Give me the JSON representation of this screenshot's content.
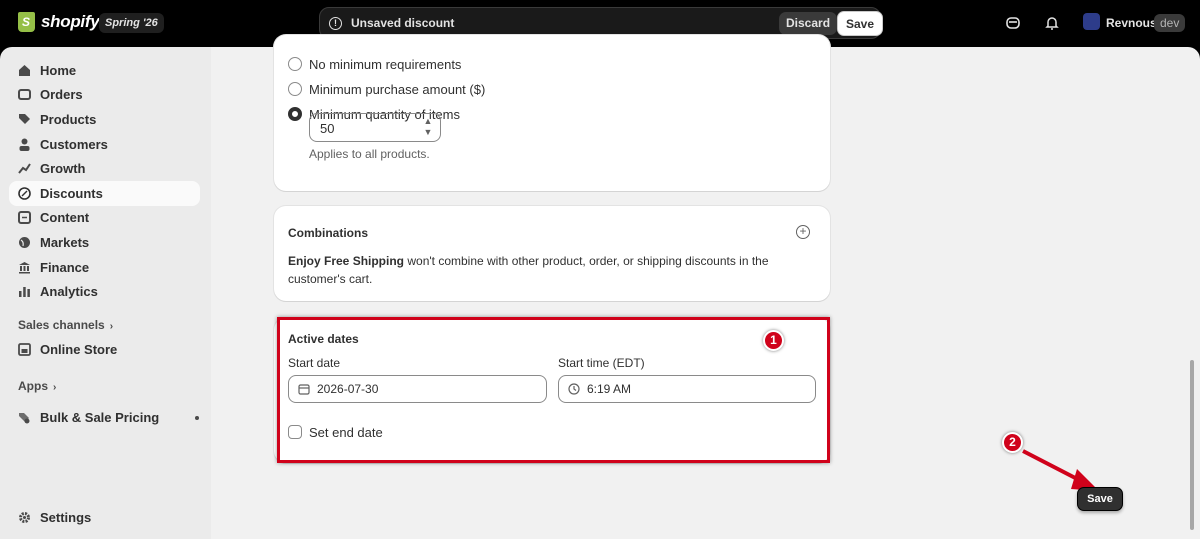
{
  "topbar": {
    "logo_text": "shopify",
    "version_badge": "Spring '26",
    "unsaved_text": "Unsaved discount",
    "discard_label": "Discard",
    "save_label": "Save",
    "store_name": "Revnous",
    "store_badge": "dev"
  },
  "sidebar": {
    "items": [
      {
        "label": "Home",
        "icon": "home-icon"
      },
      {
        "label": "Orders",
        "icon": "orders-icon"
      },
      {
        "label": "Products",
        "icon": "tag-icon"
      },
      {
        "label": "Customers",
        "icon": "person-icon"
      },
      {
        "label": "Growth",
        "icon": "growth-icon"
      },
      {
        "label": "Discounts",
        "icon": "discount-icon",
        "active": true
      },
      {
        "label": "Content",
        "icon": "content-icon"
      },
      {
        "label": "Markets",
        "icon": "globe-icon"
      },
      {
        "label": "Finance",
        "icon": "bank-icon"
      },
      {
        "label": "Analytics",
        "icon": "bar-chart-icon"
      }
    ],
    "sales_channels_label": "Sales channels",
    "online_store_label": "Online Store",
    "apps_label": "Apps",
    "app_item_label": "Bulk & Sale Pricing",
    "settings_label": "Settings"
  },
  "requirements": {
    "options": [
      "No minimum requirements",
      "Minimum purchase amount ($)",
      "Minimum quantity of items"
    ],
    "selected_index": 2,
    "quantity_value": "50",
    "help_text": "Applies to all products."
  },
  "combinations": {
    "title": "Combinations",
    "discount_name": "Enjoy Free Shipping",
    "description": " won't combine with other product, order, or shipping discounts in the customer's cart."
  },
  "active_dates": {
    "title": "Active dates",
    "start_date_label": "Start date",
    "start_date_value": "2026-07-30",
    "start_time_label": "Start time (EDT)",
    "start_time_value": "6:19 AM",
    "end_date_label": "Set end date"
  },
  "annotations": {
    "step1": "1",
    "step2": "2",
    "save_button_label": "Save",
    "accent_color": "#d0021b"
  }
}
